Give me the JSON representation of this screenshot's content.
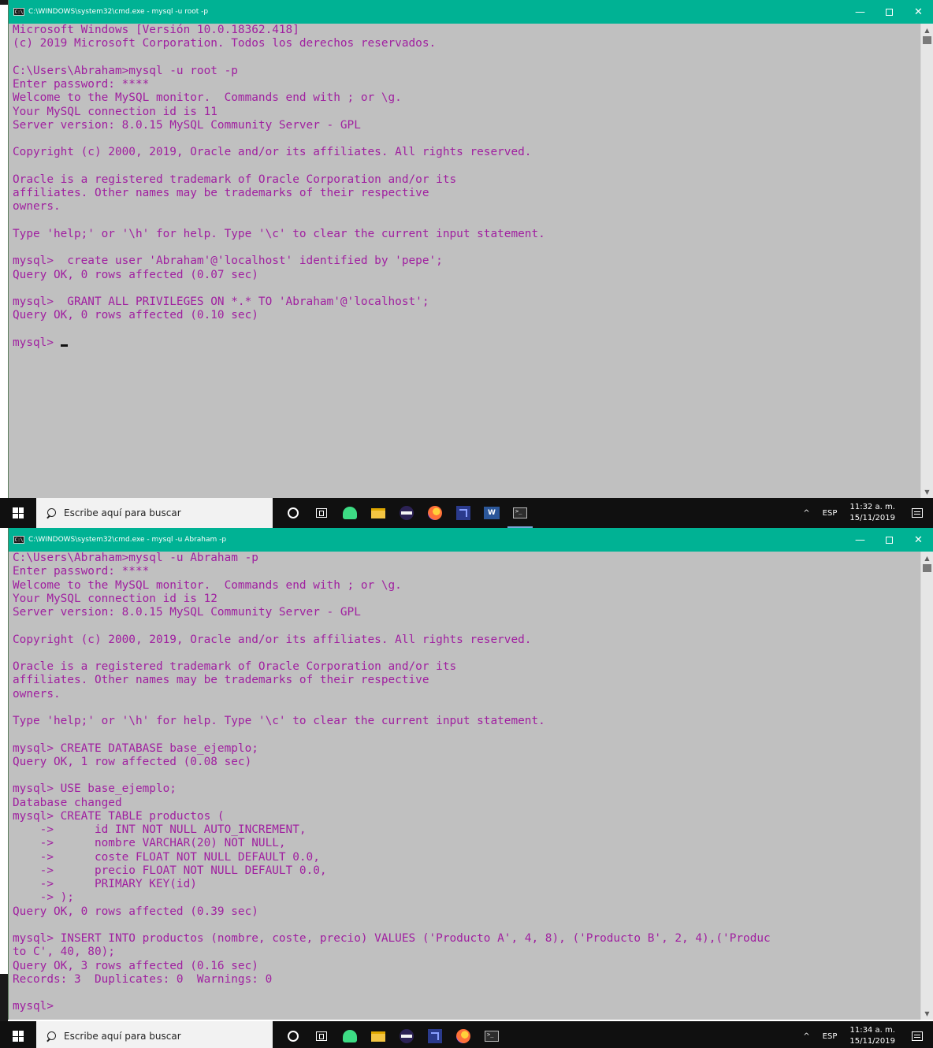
{
  "window1": {
    "title": "C:\\WINDOWS\\system32\\cmd.exe - mysql  -u root -p",
    "controls": {
      "minimize": "—",
      "close": "✕"
    },
    "lines": [
      "Microsoft Windows [Versión 10.0.18362.418]",
      "(c) 2019 Microsoft Corporation. Todos los derechos reservados.",
      "",
      "C:\\Users\\Abraham>mysql -u root -p",
      "Enter password: ****",
      "Welcome to the MySQL monitor.  Commands end with ; or \\g.",
      "Your MySQL connection id is 11",
      "Server version: 8.0.15 MySQL Community Server - GPL",
      "",
      "Copyright (c) 2000, 2019, Oracle and/or its affiliates. All rights reserved.",
      "",
      "Oracle is a registered trademark of Oracle Corporation and/or its",
      "affiliates. Other names may be trademarks of their respective",
      "owners.",
      "",
      "Type 'help;' or '\\h' for help. Type '\\c' to clear the current input statement.",
      "",
      "mysql>  create user 'Abraham'@'localhost' identified by 'pepe';",
      "Query OK, 0 rows affected (0.07 sec)",
      "",
      "mysql>  GRANT ALL PRIVILEGES ON *.* TO 'Abraham'@'localhost';",
      "Query OK, 0 rows affected (0.10 sec)",
      ""
    ],
    "prompt": "mysql> "
  },
  "window2": {
    "title": "C:\\WINDOWS\\system32\\cmd.exe - mysql  -u Abraham -p",
    "controls": {
      "minimize": "—",
      "close": "✕"
    },
    "lines": [
      "C:\\Users\\Abraham>mysql -u Abraham -p",
      "Enter password: ****",
      "Welcome to the MySQL monitor.  Commands end with ; or \\g.",
      "Your MySQL connection id is 12",
      "Server version: 8.0.15 MySQL Community Server - GPL",
      "",
      "Copyright (c) 2000, 2019, Oracle and/or its affiliates. All rights reserved.",
      "",
      "Oracle is a registered trademark of Oracle Corporation and/or its",
      "affiliates. Other names may be trademarks of their respective",
      "owners.",
      "",
      "Type 'help;' or '\\h' for help. Type '\\c' to clear the current input statement.",
      "",
      "mysql> CREATE DATABASE base_ejemplo;",
      "Query OK, 1 row affected (0.08 sec)",
      "",
      "mysql> USE base_ejemplo;",
      "Database changed",
      "mysql> CREATE TABLE productos (",
      "    ->      id INT NOT NULL AUTO_INCREMENT,",
      "    ->      nombre VARCHAR(20) NOT NULL,",
      "    ->      coste FLOAT NOT NULL DEFAULT 0.0,",
      "    ->      precio FLOAT NOT NULL DEFAULT 0.0,",
      "    ->      PRIMARY KEY(id)",
      "    -> );",
      "Query OK, 0 rows affected (0.39 sec)",
      "",
      "mysql> INSERT INTO productos (nombre, coste, precio) VALUES ('Producto A', 4, 8), ('Producto B', 2, 4),('Produc",
      "to C', 40, 80);",
      "Query OK, 3 rows affected (0.16 sec)",
      "Records: 3  Duplicates: 0  Warnings: 0",
      "",
      "mysql>"
    ]
  },
  "taskbar1": {
    "search_placeholder": "Escribe aquí para buscar",
    "apps": [
      "cortana-icon",
      "task-view-icon",
      "android-studio-icon",
      "file-explorer-icon",
      "eclipse-icon",
      "firefox-icon",
      "visual-studio-icon",
      "word-icon",
      "cmd-icon"
    ],
    "word_label": "W",
    "tray": {
      "chevron": "^",
      "lang": "ESP",
      "time": "11:32 a. m.",
      "date": "15/11/2019"
    }
  },
  "taskbar2": {
    "search_placeholder": "Escribe aquí para buscar",
    "apps": [
      "cortana-icon",
      "task-view-icon",
      "android-studio-icon",
      "file-explorer-icon",
      "eclipse-icon",
      "visual-studio-icon",
      "firefox-icon",
      "cmd-icon"
    ],
    "tray": {
      "chevron": "^",
      "lang": "ESP",
      "time": "11:34 a. m.",
      "date": "15/11/2019"
    }
  },
  "colors": {
    "titlebar": "#00b294",
    "console_bg": "#c0c0c0",
    "console_text": "#a020a0",
    "taskbar": "#101010"
  }
}
